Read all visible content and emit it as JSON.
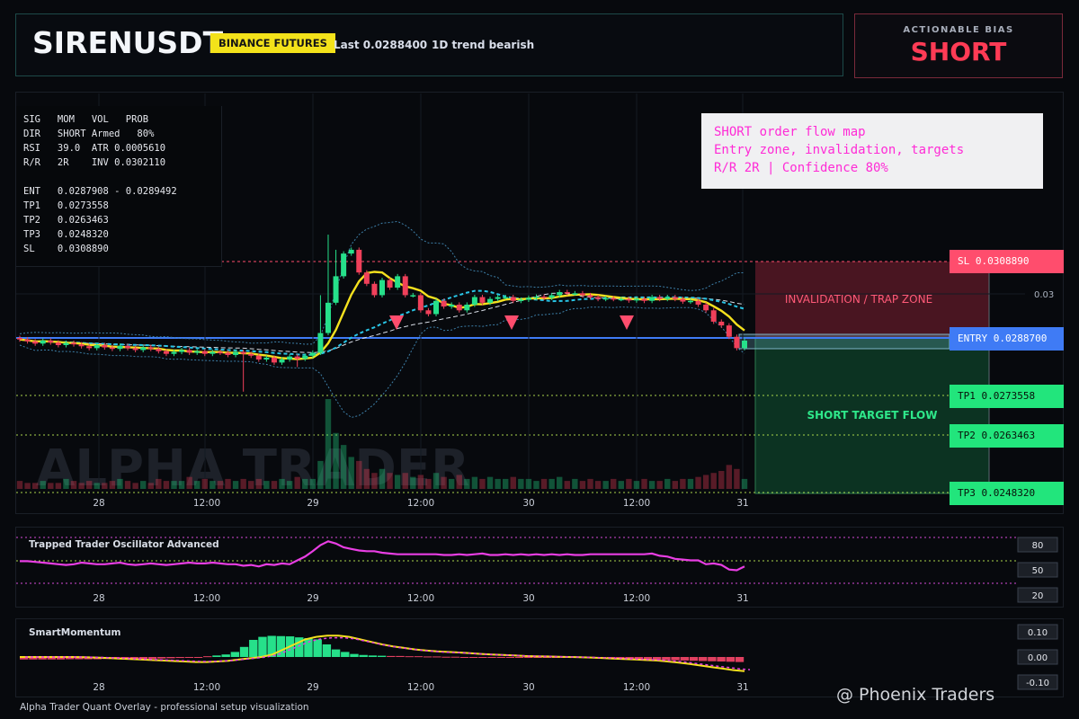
{
  "header": {
    "symbol": "SIRENUSDT",
    "exchange": "BINANCE FUTURES",
    "last": "Last 0.0288400",
    "trend": "1D trend bearish"
  },
  "bias": {
    "label": "ACTIONABLE BIAS",
    "value": "SHORT"
  },
  "stats": {
    "rows": [
      "SIG   MOM   VOL   PROB",
      "DIR   SHORT Armed   80%",
      "RSI   39.0  ATR 0.0005610",
      "R/R   2R    INV 0.0302110",
      "ENT   0.0287908 - 0.0289492",
      "TP1   0.0273558",
      "TP2   0.0263463",
      "TP3   0.0248320",
      "SL    0.0308890"
    ]
  },
  "note": {
    "line1": "SHORT order flow map",
    "line2": "Entry zone, invalidation, targets",
    "line3": "R/R 2R | Confidence 80%"
  },
  "levels": {
    "sl": "SL 0.0308890",
    "entry": "ENTRY 0.0288700",
    "tp1": "TP1 0.0273558",
    "tp2": "TP2 0.0263463",
    "tp3": "TP3 0.0248320"
  },
  "zones": {
    "invalidation": "INVALIDATION / TRAP ZONE",
    "target": "SHORT TARGET FLOW"
  },
  "watermark": "ALPHA TRADER",
  "footer": {
    "left": "Alpha Trader Quant Overlay - professional setup visualization",
    "right": "@ Phoenix Traders"
  },
  "colors": {
    "up": "#26e08a",
    "down": "#f0405a",
    "ema": "#f5e11e",
    "entry": "#3f7bf5",
    "sl": "#ff4d6d",
    "tp": "#a8d44a",
    "osc": "#e83ee3"
  },
  "chart_data": [
    {
      "type": "candlestick",
      "title": "SIRENUSDT",
      "x_tick_labels": [
        "28",
        "12:00",
        "29",
        "12:00",
        "30",
        "12:00",
        "31"
      ],
      "y_tick_labels": [
        "0.03"
      ],
      "ylim": [
        0.0247,
        0.0318
      ],
      "levels": {
        "sl": 0.030889,
        "entry": 0.02887,
        "tp1": 0.0273558,
        "tp2": 0.0263463,
        "tp3": 0.024832
      },
      "close": [
        0.02883,
        0.02878,
        0.02872,
        0.0288,
        0.02875,
        0.02868,
        0.02874,
        0.0287,
        0.02865,
        0.0286,
        0.02868,
        0.02862,
        0.02858,
        0.02866,
        0.0286,
        0.02855,
        0.02862,
        0.02858,
        0.02852,
        0.02845,
        0.0285,
        0.02855,
        0.02848,
        0.02852,
        0.02845,
        0.0285,
        0.02848,
        0.02842,
        0.0285,
        0.02845,
        0.0284,
        0.0283,
        0.02835,
        0.02822,
        0.0283,
        0.02838,
        0.02832,
        0.0284,
        0.02848,
        0.029,
        0.0298,
        0.0305,
        0.0311,
        0.0312,
        0.0306,
        0.0303,
        0.03,
        0.0304,
        0.0302,
        0.0305,
        0.03,
        0.03,
        0.0296,
        0.0295,
        0.02985,
        0.0297,
        0.02975,
        0.0296,
        0.02975,
        0.02995,
        0.0298,
        0.0299,
        0.02995,
        0.02995,
        0.02985,
        0.02988,
        0.02993,
        0.02996,
        0.02993,
        0.03,
        0.03008,
        0.03005,
        0.03005,
        0.03,
        0.02995,
        0.0299,
        0.02992,
        0.0299,
        0.0299,
        0.02986,
        0.0299,
        0.02985,
        0.02995,
        0.0299,
        0.02995,
        0.0299,
        0.02983,
        0.02985,
        0.02975,
        0.0296,
        0.0293,
        0.0292,
        0.0289,
        0.0286,
        0.0288
      ],
      "volume": [
        0.04,
        0.03,
        0.03,
        0.04,
        0.03,
        0.03,
        0.05,
        0.04,
        0.03,
        0.04,
        0.03,
        0.03,
        0.04,
        0.05,
        0.04,
        0.03,
        0.04,
        0.03,
        0.05,
        0.04,
        0.04,
        0.04,
        0.06,
        0.04,
        0.05,
        0.04,
        0.04,
        0.05,
        0.04,
        0.05,
        0.04,
        0.05,
        0.04,
        0.04,
        0.05,
        0.04,
        0.06,
        0.05,
        0.05,
        0.14,
        0.45,
        0.28,
        0.22,
        0.16,
        0.14,
        0.1,
        0.08,
        0.1,
        0.08,
        0.07,
        0.08,
        0.06,
        0.07,
        0.05,
        0.08,
        0.06,
        0.05,
        0.07,
        0.05,
        0.06,
        0.05,
        0.06,
        0.05,
        0.05,
        0.06,
        0.05,
        0.05,
        0.04,
        0.05,
        0.05,
        0.06,
        0.04,
        0.05,
        0.04,
        0.05,
        0.04,
        0.04,
        0.05,
        0.04,
        0.05,
        0.04,
        0.05,
        0.04,
        0.04,
        0.05,
        0.04,
        0.05,
        0.05,
        0.06,
        0.07,
        0.08,
        0.09,
        0.12,
        0.1,
        0.05
      ],
      "signals": [
        "sell",
        "sell",
        "sell"
      ]
    },
    {
      "type": "line",
      "title": "Trapped Trader Oscillator Advanced",
      "y_tick_labels": [
        "80",
        "50",
        "20"
      ],
      "ylim": [
        10,
        90
      ],
      "values": [
        49,
        49,
        48,
        47,
        46,
        45,
        44,
        45,
        47,
        46,
        45,
        45,
        46,
        47,
        45,
        44,
        45,
        46,
        45,
        44,
        45,
        46,
        47,
        46,
        46,
        47,
        46,
        45,
        45,
        43,
        44,
        42,
        45,
        44,
        46,
        45,
        50,
        55,
        62,
        70,
        75,
        72,
        67,
        65,
        63,
        62,
        62,
        60,
        59,
        58,
        58,
        58,
        58,
        58,
        58,
        57,
        57,
        58,
        57,
        58,
        59,
        57,
        57,
        58,
        57,
        58,
        57,
        58,
        57,
        58,
        57,
        58,
        57,
        57,
        58,
        58,
        58,
        58,
        58,
        58,
        58,
        58,
        59,
        56,
        55,
        52,
        51,
        50,
        50,
        45,
        46,
        44,
        38,
        37,
        42
      ]
    },
    {
      "type": "bar",
      "title": "SmartMomentum",
      "y_tick_labels": [
        "0.10",
        "0.00",
        "-0.10"
      ],
      "ylim": [
        -0.12,
        0.12
      ],
      "values": [
        -0.01,
        -0.01,
        -0.01,
        -0.01,
        -0.01,
        -0.009,
        -0.009,
        -0.009,
        -0.009,
        -0.008,
        -0.008,
        -0.008,
        -0.008,
        -0.007,
        -0.007,
        -0.006,
        -0.005,
        -0.004,
        -0.002,
        0.0,
        0.003,
        0.006,
        0.01,
        0.02,
        0.04,
        0.068,
        0.08,
        0.084,
        0.083,
        0.082,
        0.078,
        0.075,
        0.07,
        0.05,
        0.03,
        0.02,
        0.012,
        0.008,
        0.006,
        0.005,
        0.004,
        0.004,
        0.003,
        0.003,
        0.002,
        0.002,
        0.001,
        0.001,
        0.0,
        0.0,
        0.0,
        0.0,
        0.0,
        0.0,
        0.0,
        0.0,
        0.0,
        -0.001,
        -0.002,
        -0.002,
        -0.003,
        -0.003,
        -0.004,
        -0.005,
        -0.006,
        -0.007,
        -0.008,
        -0.009,
        -0.01,
        -0.011,
        -0.012,
        -0.013,
        -0.014,
        -0.015,
        -0.016,
        -0.017,
        -0.018,
        -0.019,
        -0.02
      ],
      "line": [
        0.0,
        0.0,
        0.0,
        0.0,
        0.0,
        0.0,
        -0.001,
        -0.002,
        -0.004,
        -0.006,
        -0.008,
        -0.01,
        -0.012,
        -0.014,
        -0.016,
        -0.018,
        -0.02,
        -0.02,
        -0.018,
        -0.015,
        -0.01,
        -0.005,
        0.0,
        0.01,
        0.03,
        0.05,
        0.07,
        0.08,
        0.085,
        0.085,
        0.08,
        0.07,
        0.06,
        0.05,
        0.042,
        0.036,
        0.03,
        0.026,
        0.022,
        0.02,
        0.018,
        0.015,
        0.012,
        0.01,
        0.008,
        0.006,
        0.004,
        0.003,
        0.002,
        0.001,
        0.0,
        -0.001,
        -0.002,
        -0.004,
        -0.006,
        -0.008,
        -0.01,
        -0.012,
        -0.014,
        -0.018,
        -0.022,
        -0.028,
        -0.034,
        -0.04,
        -0.046,
        -0.052,
        -0.056
      ]
    }
  ]
}
